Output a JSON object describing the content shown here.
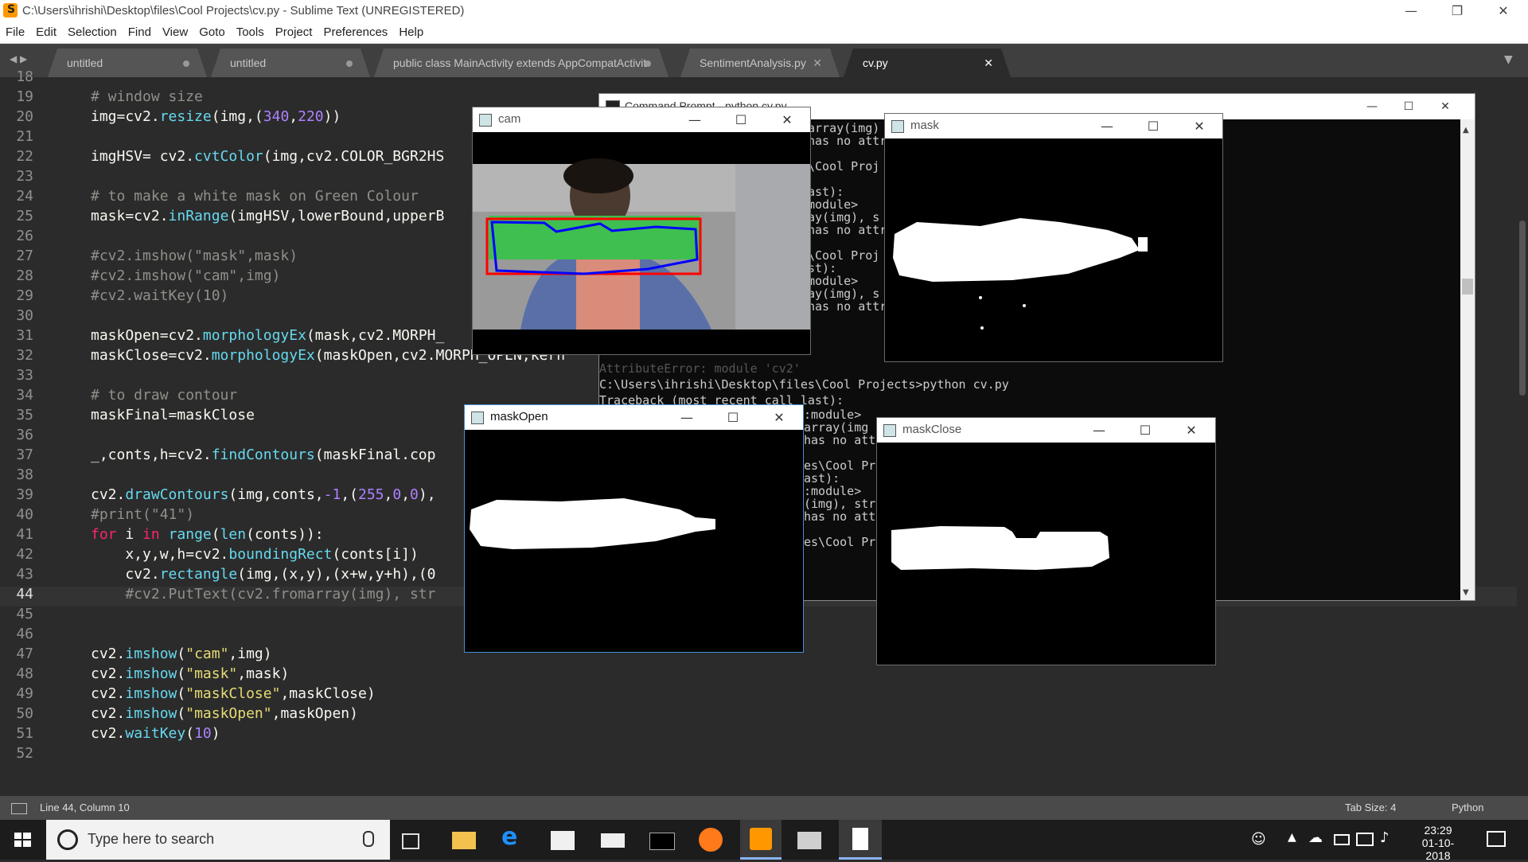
{
  "titlebar": {
    "title": "C:\\Users\\ihrishi\\Desktop\\files\\Cool Projects\\cv.py - Sublime Text (UNREGISTERED)",
    "minimize": "—",
    "restore": "❐",
    "close": "✕"
  },
  "menu": [
    "File",
    "Edit",
    "Selection",
    "Find",
    "View",
    "Goto",
    "Tools",
    "Project",
    "Preferences",
    "Help"
  ],
  "tabs": [
    {
      "label": "untitled",
      "state": "dirty"
    },
    {
      "label": "untitled",
      "state": "dirty"
    },
    {
      "label": "public class MainActivity extends AppCompatActivit",
      "state": "dirty"
    },
    {
      "label": "SentimentAnalysis.py",
      "state": "close"
    },
    {
      "label": "cv.py",
      "state": "active"
    }
  ],
  "tab_close_glyph": "✕",
  "nav_arrows": "◀ ▶",
  "tab_menu": "▼",
  "line_numbers": [
    "18",
    "19",
    "20",
    "21",
    "22",
    "23",
    "24",
    "25",
    "26",
    "27",
    "28",
    "29",
    "30",
    "31",
    "32",
    "33",
    "34",
    "35",
    "36",
    "37",
    "38",
    "39",
    "40",
    "41",
    "42",
    "43",
    "44",
    "45",
    "46",
    "47",
    "48",
    "49",
    "50",
    "51",
    "52"
  ],
  "current_line": "44",
  "code": {
    "l19": "# window size",
    "l20a": "img=cv2.",
    "l20b": "resize",
    "l20c": "(img,(",
    "l20d": "340",
    "l20e": ",",
    "l20f": "220",
    "l20g": "))",
    "l22a": "imgHSV= cv2.",
    "l22b": "cvtColor",
    "l22c": "(img,cv2.COLOR_BGR2HS",
    "l24": "# to make a white mask on Green Colour",
    "l25a": "mask=cv2.",
    "l25b": "inRange",
    "l25c": "(imgHSV,lowerBound,upperB",
    "l27": "#cv2.imshow(\"mask\",mask)",
    "l28": "#cv2.imshow(\"cam\",img)",
    "l29": "#cv2.waitKey(10)",
    "l31a": "maskOpen=cv2.",
    "l31b": "morphologyEx",
    "l31c": "(mask,cv2.MORPH_",
    "l32a": "maskClose=cv2.",
    "l32b": "morphologyEx",
    "l32c": "(maskOpen,cv2.MORPH_OPEN,kern",
    "l34": "# to draw contour",
    "l35": "maskFinal=maskClose",
    "l37a": "_,conts,h=cv2.",
    "l37b": "findContours",
    "l37c": "(maskFinal.cop",
    "l39a": "cv2.",
    "l39b": "drawContours",
    "l39c": "(img,conts,",
    "l39d": "-1",
    "l39e": ",(",
    "l39f": "255",
    "l39g": ",",
    "l39h": "0",
    "l39i": ",",
    "l39j": "0",
    "l39k": "),",
    "l40": "#print(\"41\")",
    "l41a": "for",
    "l41b": " i ",
    "l41c": "in",
    "l41d": " ",
    "l41e": "range",
    "l41f": "(",
    "l41g": "len",
    "l41h": "(conts)):",
    "l42a": "    x,y,w,h=cv2.",
    "l42b": "boundingRect",
    "l42c": "(conts[i])",
    "l43a": "    cv2.",
    "l43b": "rectangle",
    "l43c": "(img,(x,y),(x+w,y+h),(0",
    "l44": "    #cv2.PutText(cv2.fromarray(img), str",
    "l47a": "cv2.",
    "l47b": "imshow",
    "l47c": "(",
    "l47d": "\"cam\"",
    "l47e": ",img)",
    "l48a": "cv2.",
    "l48b": "imshow",
    "l48c": "(",
    "l48d": "\"mask\"",
    "l48e": ",mask)",
    "l49a": "cv2.",
    "l49b": "imshow",
    "l49c": "(",
    "l49d": "\"maskClose\"",
    "l49e": ",maskClose)",
    "l50a": "cv2.",
    "l50b": "imshow",
    "l50c": "(",
    "l50d": "\"maskOpen\"",
    "l50e": ",maskOpen)",
    "l51a": "cv2.",
    "l51b": "waitKey",
    "l51c": "(",
    "l51d": "10",
    "l51e": ")"
  },
  "cmd": {
    "title": "Command Prompt - python  cv.py",
    "lines": [
      "array(img)",
      "has no attr",
      "",
      "\\Cool Proj",
      "",
      "ast):",
      "module>",
      "ay(img), s",
      "has no attr",
      "",
      "\\Cool Proj",
      "st):",
      "module>",
      "ay(img), s",
      "has no attr"
    ],
    "prompt_line": "C:\\Users\\ihrishi\\Desktop\\files\\Cool Projects>python cv.py",
    "traceback": "Traceback (most recent call last):",
    "lines2": [
      ":module>",
      "array(img",
      "has no att",
      "",
      "es\\Cool Pro",
      "ast):",
      ":module>",
      "(img), str",
      "has no att",
      "",
      "es\\Cool Pro"
    ],
    "hidden_fragment": "AttributeError: module 'cv2'"
  },
  "windows": {
    "cam": "cam",
    "mask": "mask",
    "maskOpen": "maskOpen",
    "maskClose": "maskClose"
  },
  "status": {
    "position": "Line 44, Column 10",
    "tab_size": "Tab Size: 4",
    "syntax": "Python"
  },
  "taskbar": {
    "search_placeholder": "Type here to search",
    "time": "23:29",
    "date": "01-10-2018"
  },
  "colors": {
    "accent": "#ff9800",
    "contour": "#0000ff",
    "bbox": "#ff0000",
    "bottle": "#3fbf4f"
  }
}
